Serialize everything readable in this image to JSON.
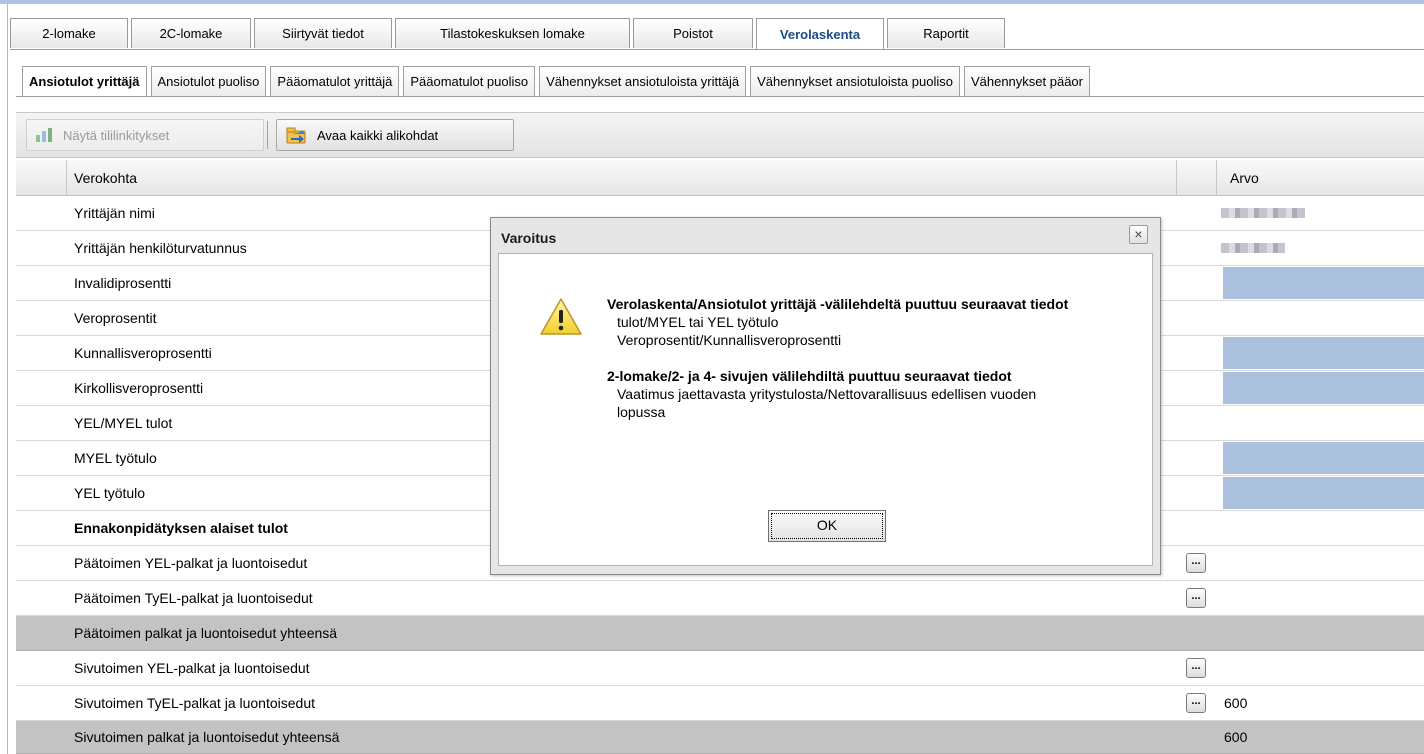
{
  "top_tabs": [
    {
      "label": "2-lomake"
    },
    {
      "label": "2C-lomake"
    },
    {
      "label": "Siirtyvät tiedot"
    },
    {
      "label": "Tilastokeskuksen lomake"
    },
    {
      "label": "Poistot"
    },
    {
      "label": "Verolaskenta",
      "active": true
    },
    {
      "label": "Raportit"
    }
  ],
  "sub_tabs": [
    {
      "label": "Ansiotulot yrittäjä",
      "active": true
    },
    {
      "label": "Ansiotulot puoliso"
    },
    {
      "label": "Pääomatulot yrittäjä"
    },
    {
      "label": "Pääomatulot puoliso"
    },
    {
      "label": "Vähennykset ansiotuloista yrittäjä"
    },
    {
      "label": "Vähennykset ansiotuloista puoliso"
    },
    {
      "label": "Vähennykset pääor"
    }
  ],
  "toolbar": {
    "show_links_label": "Näytä tililinkitykset",
    "open_all_label": "Avaa kaikki alikohdat"
  },
  "grid": {
    "col_item": "Verokohta",
    "col_value": "Arvo",
    "rows": [
      {
        "label": "Yrittäjän nimi"
      },
      {
        "label": "Yrittäjän henkilöturvatunnus"
      },
      {
        "label": "Invalidiprosentti"
      },
      {
        "label": "Veroprosentit"
      },
      {
        "label": "Kunnallisveroprosentti"
      },
      {
        "label": "Kirkollisveroprosentti"
      },
      {
        "label": "YEL/MYEL tulot"
      },
      {
        "label": "MYEL työtulo"
      },
      {
        "label": "YEL työtulo"
      },
      {
        "label": "Ennakonpidätyksen alaiset tulot"
      },
      {
        "label": "Päätoimen YEL-palkat ja luontoisedut"
      },
      {
        "label": "Päätoimen TyEL-palkat ja luontoisedut"
      },
      {
        "label": "Päätoimen palkat ja luontoisedut yhteensä"
      },
      {
        "label": "Sivutoimen YEL-palkat ja luontoisedut"
      },
      {
        "label": "Sivutoimen TyEL-palkat ja luontoisedut",
        "value": "600"
      },
      {
        "label": "Sivutoimen palkat ja luontoisedut yhteensä",
        "value": "600"
      }
    ],
    "more_button_label": "..."
  },
  "dialog": {
    "title": "Varoitus",
    "close_label": "×",
    "heading1": "Verolaskenta/Ansiotulot yrittäjä -välilehdeltä puuttuu seuraavat tiedot",
    "item1": "tulot/MYEL tai YEL työtulo",
    "item2": "Veroprosentit/Kunnallisveroprosentti",
    "heading2": "2-lomake/2- ja 4- sivujen välilehdiltä puuttuu seuraavat tiedot",
    "item3": "Vaatimus jaettavasta yritystulosta/Nettovarallisuus edellisen vuoden lopussa",
    "ok_label": "OK",
    "icon": "warning-icon"
  },
  "colors": {
    "active_tab_text": "#1a4c8a",
    "input_cell": "#aac0dc",
    "total_row": "#c3c3c3",
    "top_accent": "#a9c4e6"
  }
}
